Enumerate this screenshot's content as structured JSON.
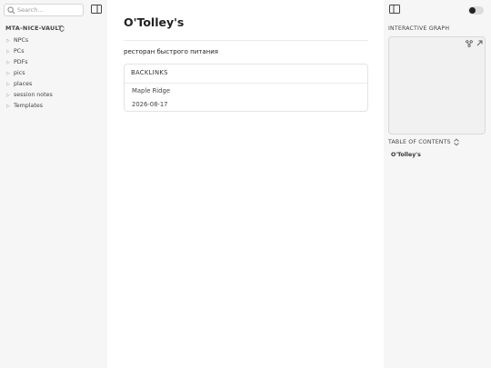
{
  "left_sidebar": {
    "search": {
      "placeholder": "Search..."
    },
    "vault_name": "MTA-NICE-VAULT",
    "tree": [
      {
        "label": "NPCs"
      },
      {
        "label": "PCs"
      },
      {
        "label": "PDFs"
      },
      {
        "label": "pics"
      },
      {
        "label": "places"
      },
      {
        "label": "session notes"
      },
      {
        "label": "Templates"
      }
    ]
  },
  "note": {
    "title": "O'Tolley's",
    "body": "ресторан быстрого питания",
    "backlinks": {
      "header": "BACKLINKS",
      "items": [
        "Maple Ridge",
        "2026-08-17"
      ]
    }
  },
  "right_sidebar": {
    "graph_header": "INTERACTIVE GRAPH",
    "toc_header": "TABLE OF CONTENTS",
    "toc_items": [
      "O'Tolley's"
    ],
    "theme_toggle": {
      "state": "off"
    }
  }
}
